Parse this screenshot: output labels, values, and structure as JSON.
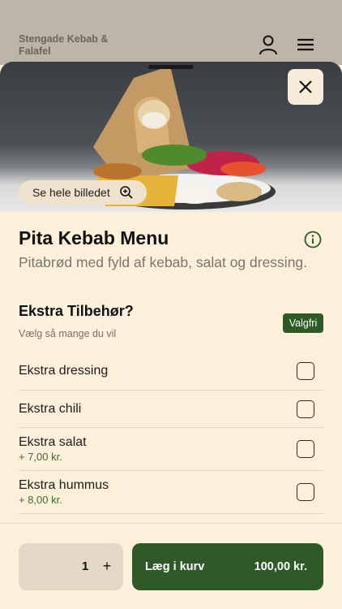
{
  "header": {
    "brand": "Stengade Kebab & Falafel",
    "profile_icon": "user-icon",
    "menu_icon": "hamburger-menu-icon"
  },
  "hero": {
    "view_image_label": "Se hele billedet",
    "zoom_icon": "zoom-in-icon",
    "close_icon": "close-icon"
  },
  "product": {
    "title": "Pita Kebab Menu",
    "description": "Pitabrød med fyld af kebab, salat og dressing.",
    "info_icon": "info-icon"
  },
  "extras": {
    "title": "Ekstra Tilbehør?",
    "subtitle": "Vælg så mange du vil",
    "badge": "Valgfri",
    "options": [
      {
        "name": "Ekstra dressing",
        "price": "",
        "checked": false
      },
      {
        "name": "Ekstra chili",
        "price": "",
        "checked": false
      },
      {
        "name": "Ekstra salat",
        "price": "+ 7,00 kr.",
        "checked": false
      },
      {
        "name": "Ekstra hummus",
        "price": "+ 8,00 kr.",
        "checked": false
      }
    ]
  },
  "footer": {
    "quantity": "1",
    "plus_label": "+",
    "add_to_cart_label": "Læg i kurv",
    "total": "100,00 kr."
  },
  "colors": {
    "accent_green": "#2d5a27",
    "background": "#fdf0da",
    "price_green": "#3f6a33"
  }
}
